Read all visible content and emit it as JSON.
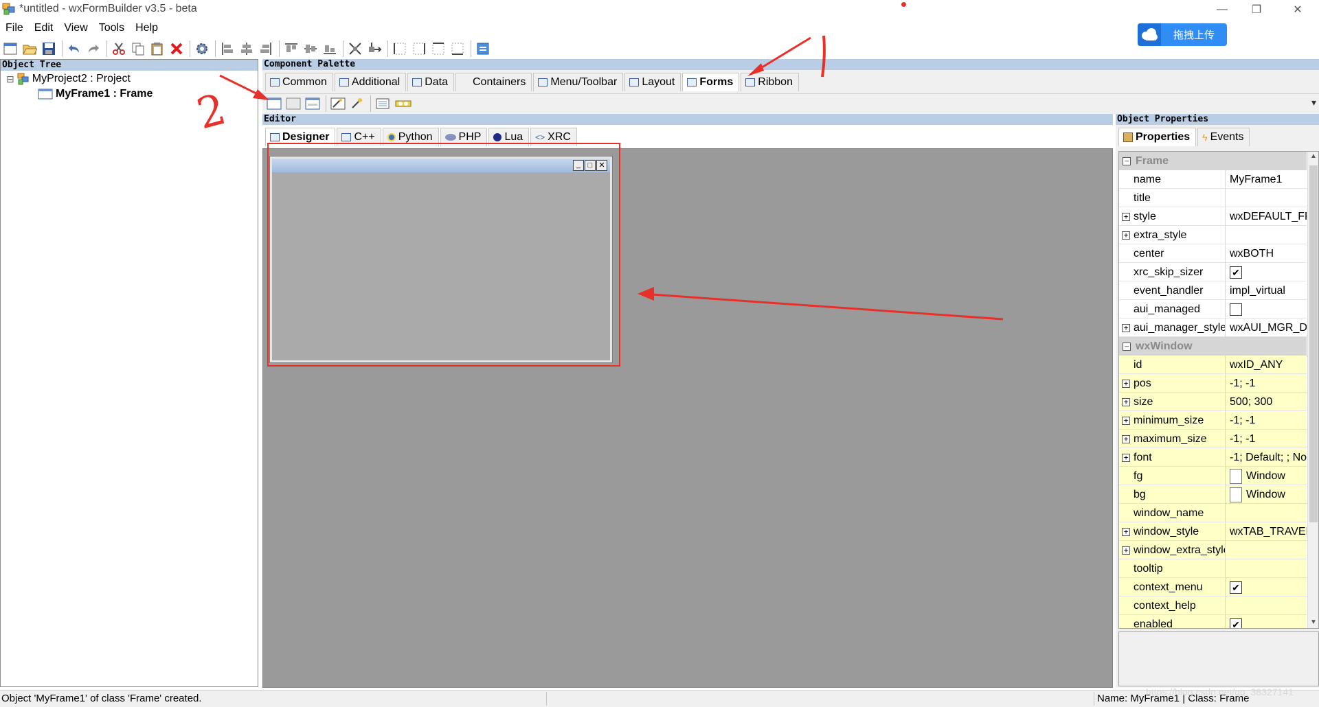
{
  "window": {
    "title": "*untitled - wxFormBuilder v3.5 - beta",
    "minimize_glyph": "—",
    "maximize_glyph": "❐",
    "close_glyph": "✕"
  },
  "overlay": {
    "upload_button": "拖拽上传",
    "annotation_1": "1",
    "annotation_2": "2",
    "annotation_color": "#e8302a"
  },
  "menubar": {
    "items": [
      "File",
      "Edit",
      "View",
      "Tools",
      "Help"
    ]
  },
  "toolbar": {
    "icons": [
      "new-file-icon",
      "open-folder-icon",
      "save-icon",
      "undo-icon",
      "redo-icon",
      "cut-icon",
      "copy-icon",
      "paste-icon",
      "delete-icon",
      "generate-code-icon",
      "align-left-icon",
      "align-center-icon",
      "align-right-icon",
      "align-top-icon",
      "align-middle-icon",
      "align-bottom-icon",
      "expand-icon",
      "stretch-icon",
      "border-left-icon",
      "border-right-icon",
      "border-top-icon",
      "border-bottom-icon",
      "xrc-preview-icon"
    ]
  },
  "object_tree": {
    "header": "Object Tree",
    "items": [
      {
        "label": "MyProject2 : Project",
        "expander": "⊟",
        "bold": false
      },
      {
        "label": "MyFrame1 : Frame",
        "bold": true
      }
    ]
  },
  "palette": {
    "header": "Component Palette",
    "tabs": [
      "Common",
      "Additional",
      "Data",
      "Containers",
      "Menu/Toolbar",
      "Layout",
      "Forms",
      "Ribbon"
    ],
    "active_tab": "Forms",
    "forms_icons": [
      "frame-icon",
      "panel-icon",
      "dialog-icon",
      "wizard-icon",
      "menu-bar-icon",
      "toolbar-icon",
      "timer-icon"
    ],
    "scroll_glyph": "▾"
  },
  "editor": {
    "header": "Editor",
    "tabs": [
      "Designer",
      "C++",
      "Python",
      "PHP",
      "Lua",
      "XRC"
    ],
    "active_tab": "Designer",
    "frame_buttons": [
      "_",
      "□",
      "✕"
    ]
  },
  "properties": {
    "header": "Object Properties",
    "tabs": [
      "Properties",
      "Events"
    ],
    "active_tab": "Properties",
    "frame_category": "Frame",
    "window_category": "wxWindow",
    "rows": [
      {
        "name": "name",
        "value": "MyFrame1",
        "expandable": false,
        "value_type": "text"
      },
      {
        "name": "title",
        "value": "",
        "expandable": false,
        "value_type": "text"
      },
      {
        "name": "style",
        "value": "wxDEFAULT_FR",
        "expandable": true,
        "value_type": "text"
      },
      {
        "name": "extra_style",
        "value": "",
        "expandable": true,
        "value_type": "text"
      },
      {
        "name": "center",
        "value": "wxBOTH",
        "expandable": false,
        "value_type": "text"
      },
      {
        "name": "xrc_skip_sizer",
        "value": true,
        "expandable": false,
        "value_type": "bool"
      },
      {
        "name": "event_handler",
        "value": "impl_virtual",
        "expandable": false,
        "value_type": "text"
      },
      {
        "name": "aui_managed",
        "value": false,
        "expandable": false,
        "value_type": "bool"
      },
      {
        "name": "aui_manager_style",
        "value": "wxAUI_MGR_DE",
        "expandable": true,
        "value_type": "text"
      }
    ],
    "window_rows": [
      {
        "name": "id",
        "value": "wxID_ANY",
        "expandable": false,
        "value_type": "text"
      },
      {
        "name": "pos",
        "value": "-1; -1",
        "expandable": true,
        "value_type": "text"
      },
      {
        "name": "size",
        "value": "500; 300",
        "expandable": true,
        "value_type": "text"
      },
      {
        "name": "minimum_size",
        "value": "-1; -1",
        "expandable": true,
        "value_type": "text"
      },
      {
        "name": "maximum_size",
        "value": "-1; -1",
        "expandable": true,
        "value_type": "text"
      },
      {
        "name": "font",
        "value": "-1; Default; ; No",
        "expandable": true,
        "value_type": "text"
      },
      {
        "name": "fg",
        "value": "Window",
        "expandable": false,
        "value_type": "color"
      },
      {
        "name": "bg",
        "value": "Window",
        "expandable": false,
        "value_type": "color"
      },
      {
        "name": "window_name",
        "value": "",
        "expandable": false,
        "value_type": "text"
      },
      {
        "name": "window_style",
        "value": "wxTAB_TRAVER",
        "expandable": true,
        "value_type": "text"
      },
      {
        "name": "window_extra_style",
        "value": "",
        "expandable": true,
        "value_type": "text"
      },
      {
        "name": "tooltip",
        "value": "",
        "expandable": false,
        "value_type": "text"
      },
      {
        "name": "context_menu",
        "value": true,
        "expandable": false,
        "value_type": "bool"
      },
      {
        "name": "context_help",
        "value": "",
        "expandable": false,
        "value_type": "text"
      },
      {
        "name": "enabled",
        "value": true,
        "expandable": false,
        "value_type": "bool"
      }
    ],
    "row_colors": {
      "frame": "#ffffff",
      "window": "#ffffc8"
    },
    "scroll_up_glyph": "▲",
    "scroll_down_glyph": "▼"
  },
  "statusbar": {
    "message": "Object 'MyFrame1' of class 'Frame' created.",
    "info": "Name: MyFrame1 | Class: Frame",
    "watermark": "https://blog.csdn.net/qq_38327141"
  }
}
